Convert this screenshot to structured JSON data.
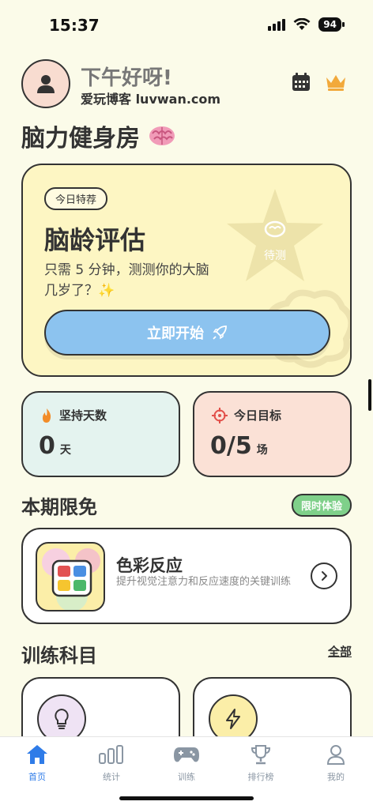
{
  "status": {
    "time": "15:37",
    "battery": "94"
  },
  "header": {
    "greeting": "下午好呀!",
    "subtitle": "爱玩博客 luvwan.com",
    "calendar_icon": "calendar-icon",
    "vip_icon": "crown-icon"
  },
  "page_title": "脑力健身房",
  "featured": {
    "tag": "今日特荐",
    "title": "脑龄评估",
    "description": "只需 5 分钟，测测你的大脑几岁了？✨",
    "badge": "待测",
    "button_label": "立即开始"
  },
  "stats": [
    {
      "label": "坚持天数",
      "value": "0",
      "unit": "天",
      "icon": "flame-icon",
      "bg": "#e4f3ef"
    },
    {
      "label": "今日目标",
      "value": "0/5",
      "unit": "场",
      "icon": "target-icon",
      "bg": "#fbe1d6"
    }
  ],
  "limited": {
    "section_title": "本期限免",
    "badge": "限时体验",
    "card_title": "色彩反应",
    "card_desc": "提升视觉注意力和反应速度的关键训练"
  },
  "training": {
    "section_title": "训练科目",
    "all_link": "全部"
  },
  "tabs": [
    {
      "label": "首页",
      "icon": "home-icon",
      "active": true
    },
    {
      "label": "统计",
      "icon": "stats-icon",
      "active": false
    },
    {
      "label": "训练",
      "icon": "gamepad-icon",
      "active": false
    },
    {
      "label": "排行榜",
      "icon": "trophy-icon",
      "active": false
    },
    {
      "label": "我的",
      "icon": "profile-icon",
      "active": false
    }
  ],
  "colors": {
    "background": "#fbfbe9",
    "featured_bg": "#fdf6c3",
    "primary_button": "#8cc3ef",
    "badge_green": "#7fd08a",
    "tab_active": "#2f7ce8"
  }
}
